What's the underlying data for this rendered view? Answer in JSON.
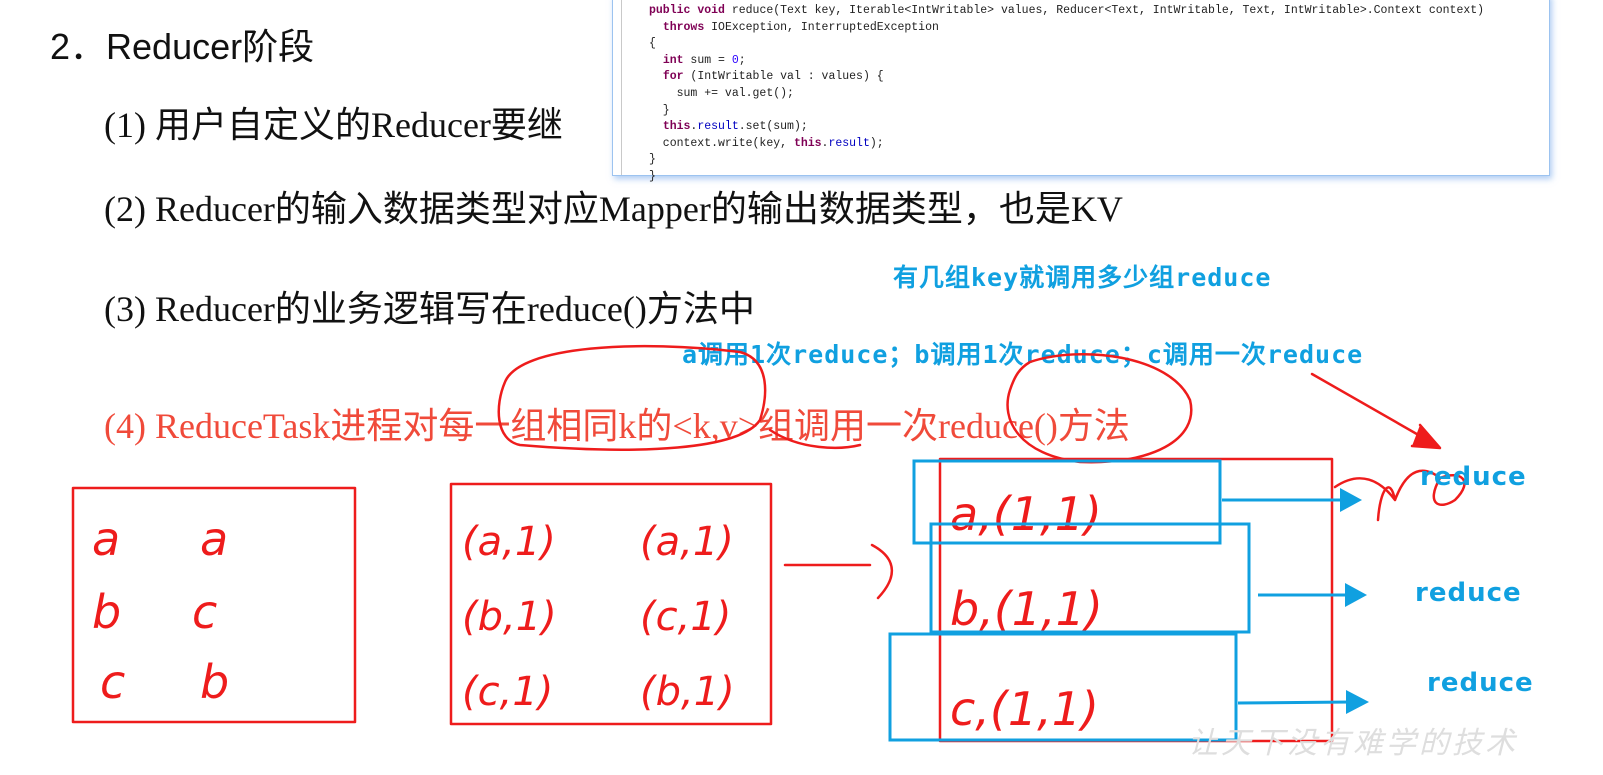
{
  "slide": {
    "heading": "2．Reducer阶段",
    "items": [
      {
        "label": "(1) 用户自定义的Reducer要继",
        "color": "#111111"
      },
      {
        "label": "(2) Reducer的输入数据类型对应Mapper的输出数据类型，也是KV",
        "color": "#111111"
      },
      {
        "label": "(3) Reducer的业务逻辑写在reduce()方法中",
        "color": "#111111"
      },
      {
        "label": "(4) ReduceTask进程对每一组相同k的<k,v>组调用一次reduce()方法",
        "color": "#f04a3a"
      }
    ]
  },
  "code_snippet": {
    "lines": [
      "public void reduce(Text key, Iterable<IntWritable> values, Reducer<Text, IntWritable, Text, IntWritable>.Context context)",
      "  throws IOException, InterruptedException",
      "{",
      "  int sum = 0;",
      "  for (IntWritable val : values) {",
      "    sum += val.get();",
      "  }",
      "  this.result.set(sum);",
      "  context.write(key, this.result);",
      "}",
      "}"
    ]
  },
  "annotations": {
    "note_groups": "有几组key就调用多少组reduce",
    "note_calls": "a调用1次reduce；b调用1次reduce；c调用一次reduce",
    "reduce_labels": [
      "reduce",
      "reduce",
      "reduce"
    ],
    "handwriting": {
      "input_box": [
        "a",
        "a",
        "b",
        "c",
        "c",
        "b"
      ],
      "kv_box": [
        "(a,1)",
        "(a,1)",
        "(b,1)",
        "(c,1)",
        "(c,1)",
        "(b,1)"
      ],
      "grouped_box": [
        "a,(1,1)",
        "b,(1,1)",
        "c,(1,1)"
      ]
    },
    "colors": {
      "pen_red": "#ee1c1c",
      "highlight_blue": "#10a0e0"
    }
  },
  "watermark": "让天下没有难学的技术"
}
